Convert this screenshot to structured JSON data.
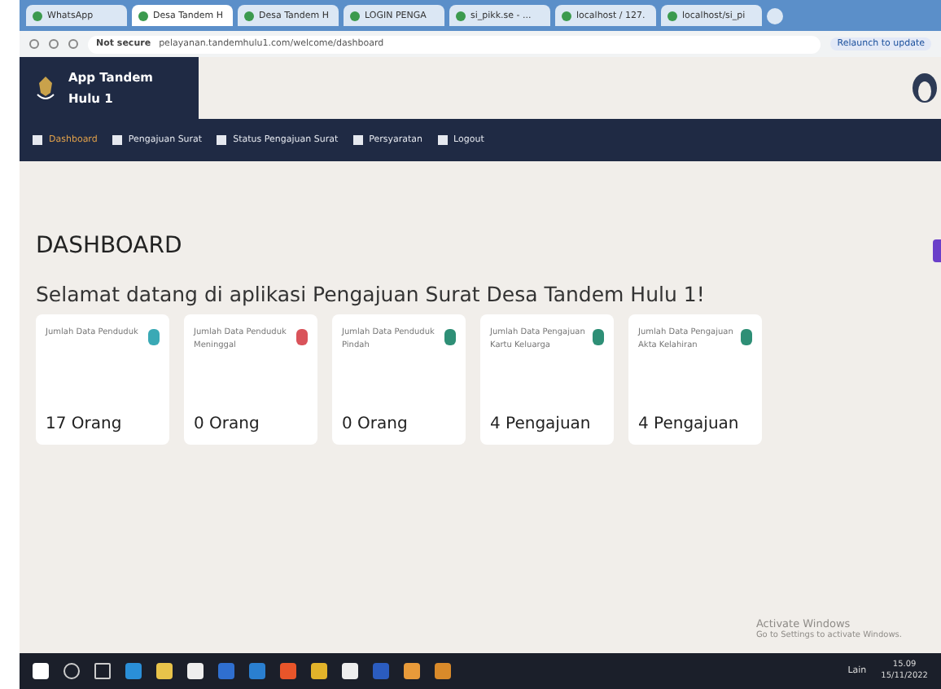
{
  "browser": {
    "tabs": [
      {
        "label": "WhatsApp",
        "selected": false
      },
      {
        "label": "Desa Tandem H",
        "selected": true
      },
      {
        "label": "Desa Tandem H",
        "selected": false
      },
      {
        "label": "LOGIN PENGA",
        "selected": false
      },
      {
        "label": "si_pikk.se - ...",
        "selected": false
      },
      {
        "label": "localhost / 127.",
        "selected": false
      },
      {
        "label": "localhost/si_pi",
        "selected": false
      }
    ],
    "security": "Not secure",
    "url": "pelayanan.tandemhulu1.com/welcome/dashboard",
    "update_button": "Relaunch to update"
  },
  "app": {
    "brand": "App Tandem Hulu 1",
    "nav": [
      {
        "label": "Dashboard",
        "selected": true
      },
      {
        "label": "Pengajuan Surat",
        "selected": false
      },
      {
        "label": "Status Pengajuan Surat",
        "selected": false
      },
      {
        "label": "Persyaratan",
        "selected": false
      },
      {
        "label": "Logout",
        "selected": false
      }
    ],
    "page_title": "DASHBOARD",
    "welcome": "Selamat datang di aplikasi Pengajuan Surat Desa Tandem Hulu 1!",
    "cards": [
      {
        "label": "Jumlah Data Penduduk",
        "value": "17 Orang",
        "color": "#3aa9b5"
      },
      {
        "label": "Jumlah Data Penduduk Meninggal",
        "value": "0 Orang",
        "color": "#d9535a"
      },
      {
        "label": "Jumlah Data Penduduk Pindah",
        "value": "0 Orang",
        "color": "#2e8f76"
      },
      {
        "label": "Jumlah Data Pengajuan Kartu Keluarga",
        "value": "4 Pengajuan",
        "color": "#2e8f76"
      },
      {
        "label": "Jumlah Data Pengajuan Akta Kelahiran",
        "value": "4 Pengajuan",
        "color": "#2e8f76"
      }
    ]
  },
  "watermark_os": {
    "title": "Activate Windows",
    "subtitle": "Go to Settings to activate Windows."
  },
  "taskbar": {
    "language": "Lain",
    "time": "15.09",
    "date": "15/11/2022"
  }
}
